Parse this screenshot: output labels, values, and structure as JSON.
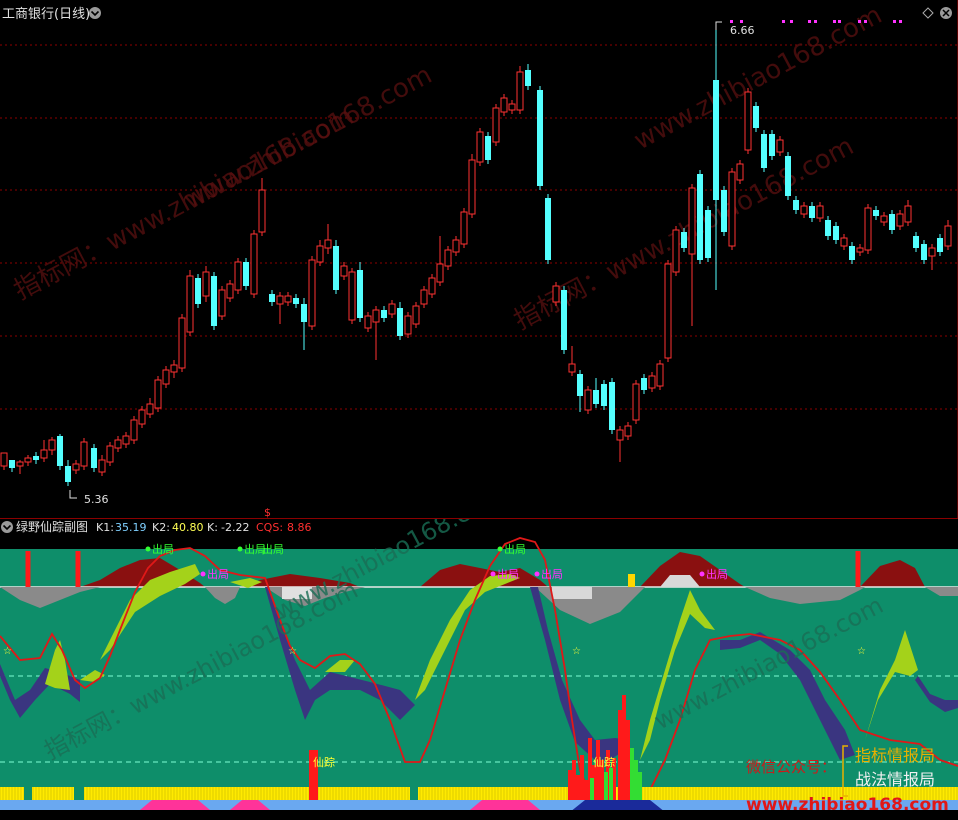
{
  "main_chart": {
    "title": "工商银行(日线)",
    "high_label": "6.66",
    "low_label": "5.36",
    "signal_mark": "$",
    "watermarks": [
      "指标网：www.zhibiao168.com",
      "www.zhibiao168.com",
      "指标网：www.zhibiao168.com",
      "www.zhibiao168.com"
    ]
  },
  "indicator": {
    "name": "绿野仙踪副图",
    "k1_label": "K1:",
    "k1_value": "35.19",
    "k2_label": "K2:",
    "k2_value": "40.80",
    "k_label": "K:",
    "k_value": "-2.22",
    "cqs_label": "CQS:",
    "cqs_value": "8.86",
    "exit_signals": [
      "出局",
      "出局",
      "出局",
      "出局"
    ],
    "exit_signals_magenta": [
      "出局",
      "出局",
      "出局",
      "出局"
    ],
    "trace_signals": [
      "仙踪",
      "仙踪"
    ],
    "promo_line1_a": "微信公众号：",
    "promo_line1_b": "指标情报局",
    "promo_line2": "战法情报局",
    "promo_url": "www.zhibiao168.com",
    "watermarks": [
      "www.zhibiao168.com",
      "指标网：www.zhibiao168.com"
    ]
  },
  "colors": {
    "up": "#ff3232",
    "down": "#54ffff",
    "bg_indicator": "#0e8e6a",
    "grid": "#8b0000"
  }
}
